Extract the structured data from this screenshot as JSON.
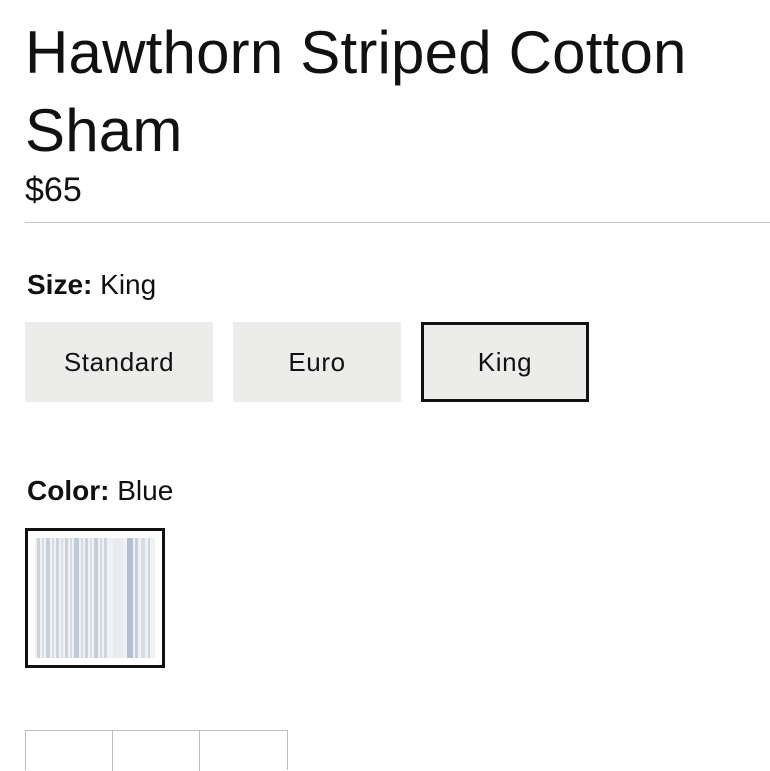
{
  "product": {
    "title": "Hawthorn Striped Cotton Sham",
    "price": "$65"
  },
  "size": {
    "label": "Size:",
    "selected": "King",
    "options": [
      "Standard",
      "Euro",
      "King"
    ]
  },
  "color": {
    "label": "Color:",
    "selected": "Blue",
    "swatch_icon": "blue-striped-fabric-swatch"
  },
  "colors": {
    "text": "#111111",
    "button_bg": "#ececea",
    "divider": "#c8c8c8",
    "swatch_stripe": "#a9b7cc"
  }
}
